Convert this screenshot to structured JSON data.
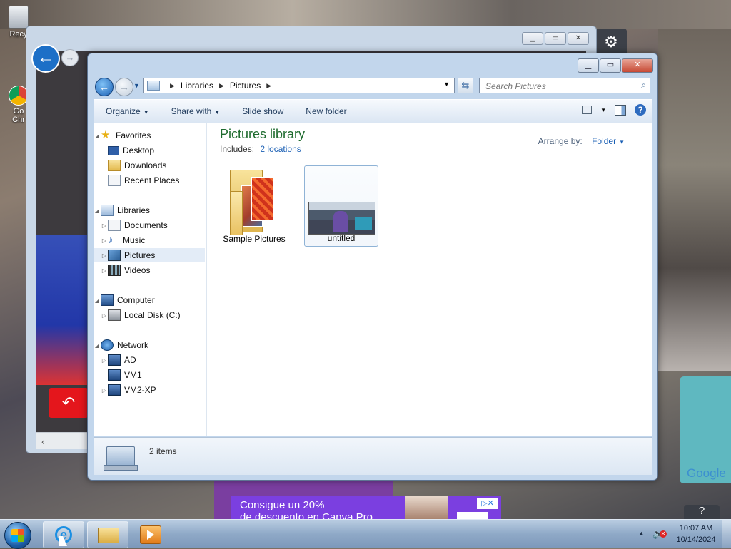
{
  "desktop": {
    "icons": [
      {
        "label": "Recy"
      },
      {
        "label": "Go\nChr"
      }
    ]
  },
  "explorer": {
    "title_buttons": {
      "minimize": "▁",
      "maximize": "▭",
      "close": "✕"
    },
    "breadcrumb": [
      "Libraries",
      "Pictures"
    ],
    "search_placeholder": "Search Pictures",
    "toolbar": {
      "organize": "Organize",
      "share_with": "Share with",
      "slide_show": "Slide show",
      "new_folder": "New folder"
    },
    "nav": {
      "favorites": "Favorites",
      "desktop": "Desktop",
      "downloads": "Downloads",
      "recent_places": "Recent Places",
      "libraries": "Libraries",
      "documents": "Documents",
      "music": "Music",
      "pictures": "Pictures",
      "videos": "Videos",
      "computer": "Computer",
      "local_disk": "Local Disk (C:)",
      "network": "Network",
      "ad": "AD",
      "vm1": "VM1",
      "vm2": "VM2-XP"
    },
    "content": {
      "title": "Pictures library",
      "includes_label": "Includes:",
      "includes_link": "2 locations",
      "arrange_label": "Arrange by:",
      "arrange_value": "Folder",
      "items": [
        {
          "label": "Sample Pictures",
          "type": "folder"
        },
        {
          "label": "untitled",
          "type": "image",
          "selected": true
        }
      ]
    },
    "details": {
      "count": "2 items"
    }
  },
  "ad": {
    "text_line1": "Consigue un 20%",
    "text_line2": "de descuento en Canva Pro"
  },
  "taskbar": {
    "time": "10:07 AM",
    "date": "10/14/2024"
  },
  "colors": {
    "library_title": "#1e6b2e",
    "link": "#1a5fb4",
    "close_button": "#c74a35"
  }
}
